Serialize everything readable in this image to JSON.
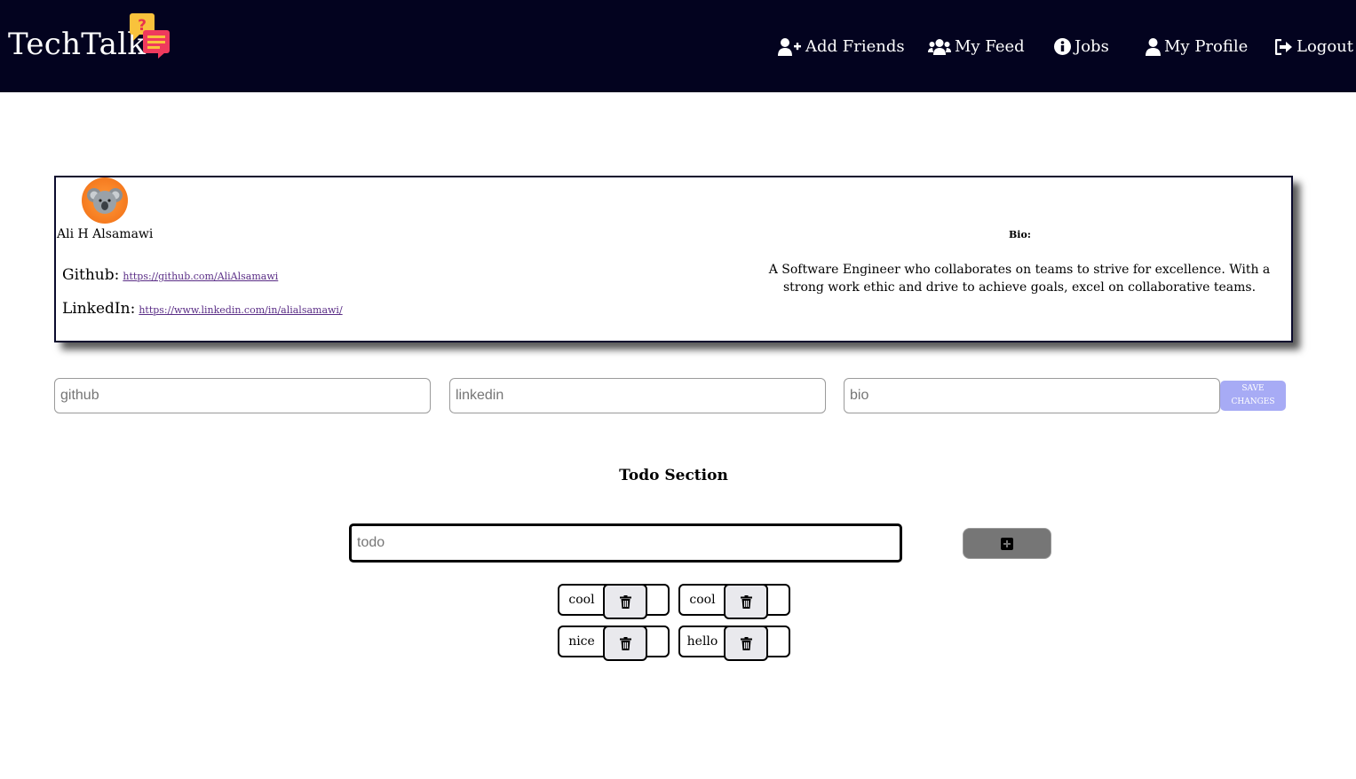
{
  "navbar": {
    "brand": "TechTalk",
    "logo_icon": "chat-bubbles-icon",
    "links": [
      {
        "label": "Add Friends",
        "icon": "user-plus-icon"
      },
      {
        "label": "My Feed",
        "icon": "users-icon"
      },
      {
        "label": "Jobs",
        "icon": "info-circle-icon"
      },
      {
        "label": "My Profile",
        "icon": "user-icon"
      },
      {
        "label": "Logout",
        "icon": "sign-out-icon"
      }
    ]
  },
  "profile": {
    "avatar": "koala-avatar",
    "name": "Ali H Alsamawi",
    "github_label": "Github:",
    "github_url": "https://github.com/AliAlsamawi",
    "linkedin_label": "LinkedIn:",
    "linkedin_url": "https://www.linkedin.com/in/alialsamawi/",
    "bio_label": "Bio:",
    "bio_text": "A Software Engineer who collaborates on teams to strive for excellence. With a strong work ethic and drive to achieve goals, excel on collaborative teams."
  },
  "edit_form": {
    "github_placeholder": "github",
    "linkedin_placeholder": "linkedin",
    "bio_placeholder": "bio",
    "save_label": "SAVE CHANGES"
  },
  "todo": {
    "title": "Todo Section",
    "input_placeholder": "todo",
    "add_icon": "plus-square-icon",
    "items": [
      {
        "text": "cool",
        "delete_icon": "trash-icon"
      },
      {
        "text": "cool",
        "delete_icon": "trash-icon"
      },
      {
        "text": "nice",
        "delete_icon": "trash-icon"
      },
      {
        "text": "hello",
        "delete_icon": "trash-icon"
      }
    ]
  },
  "colors": {
    "navbar_bg": "#03031f",
    "save_button_bg": "#a7abf5",
    "add_button_bg": "#767676",
    "avatar_bg": "#f57a1f"
  }
}
